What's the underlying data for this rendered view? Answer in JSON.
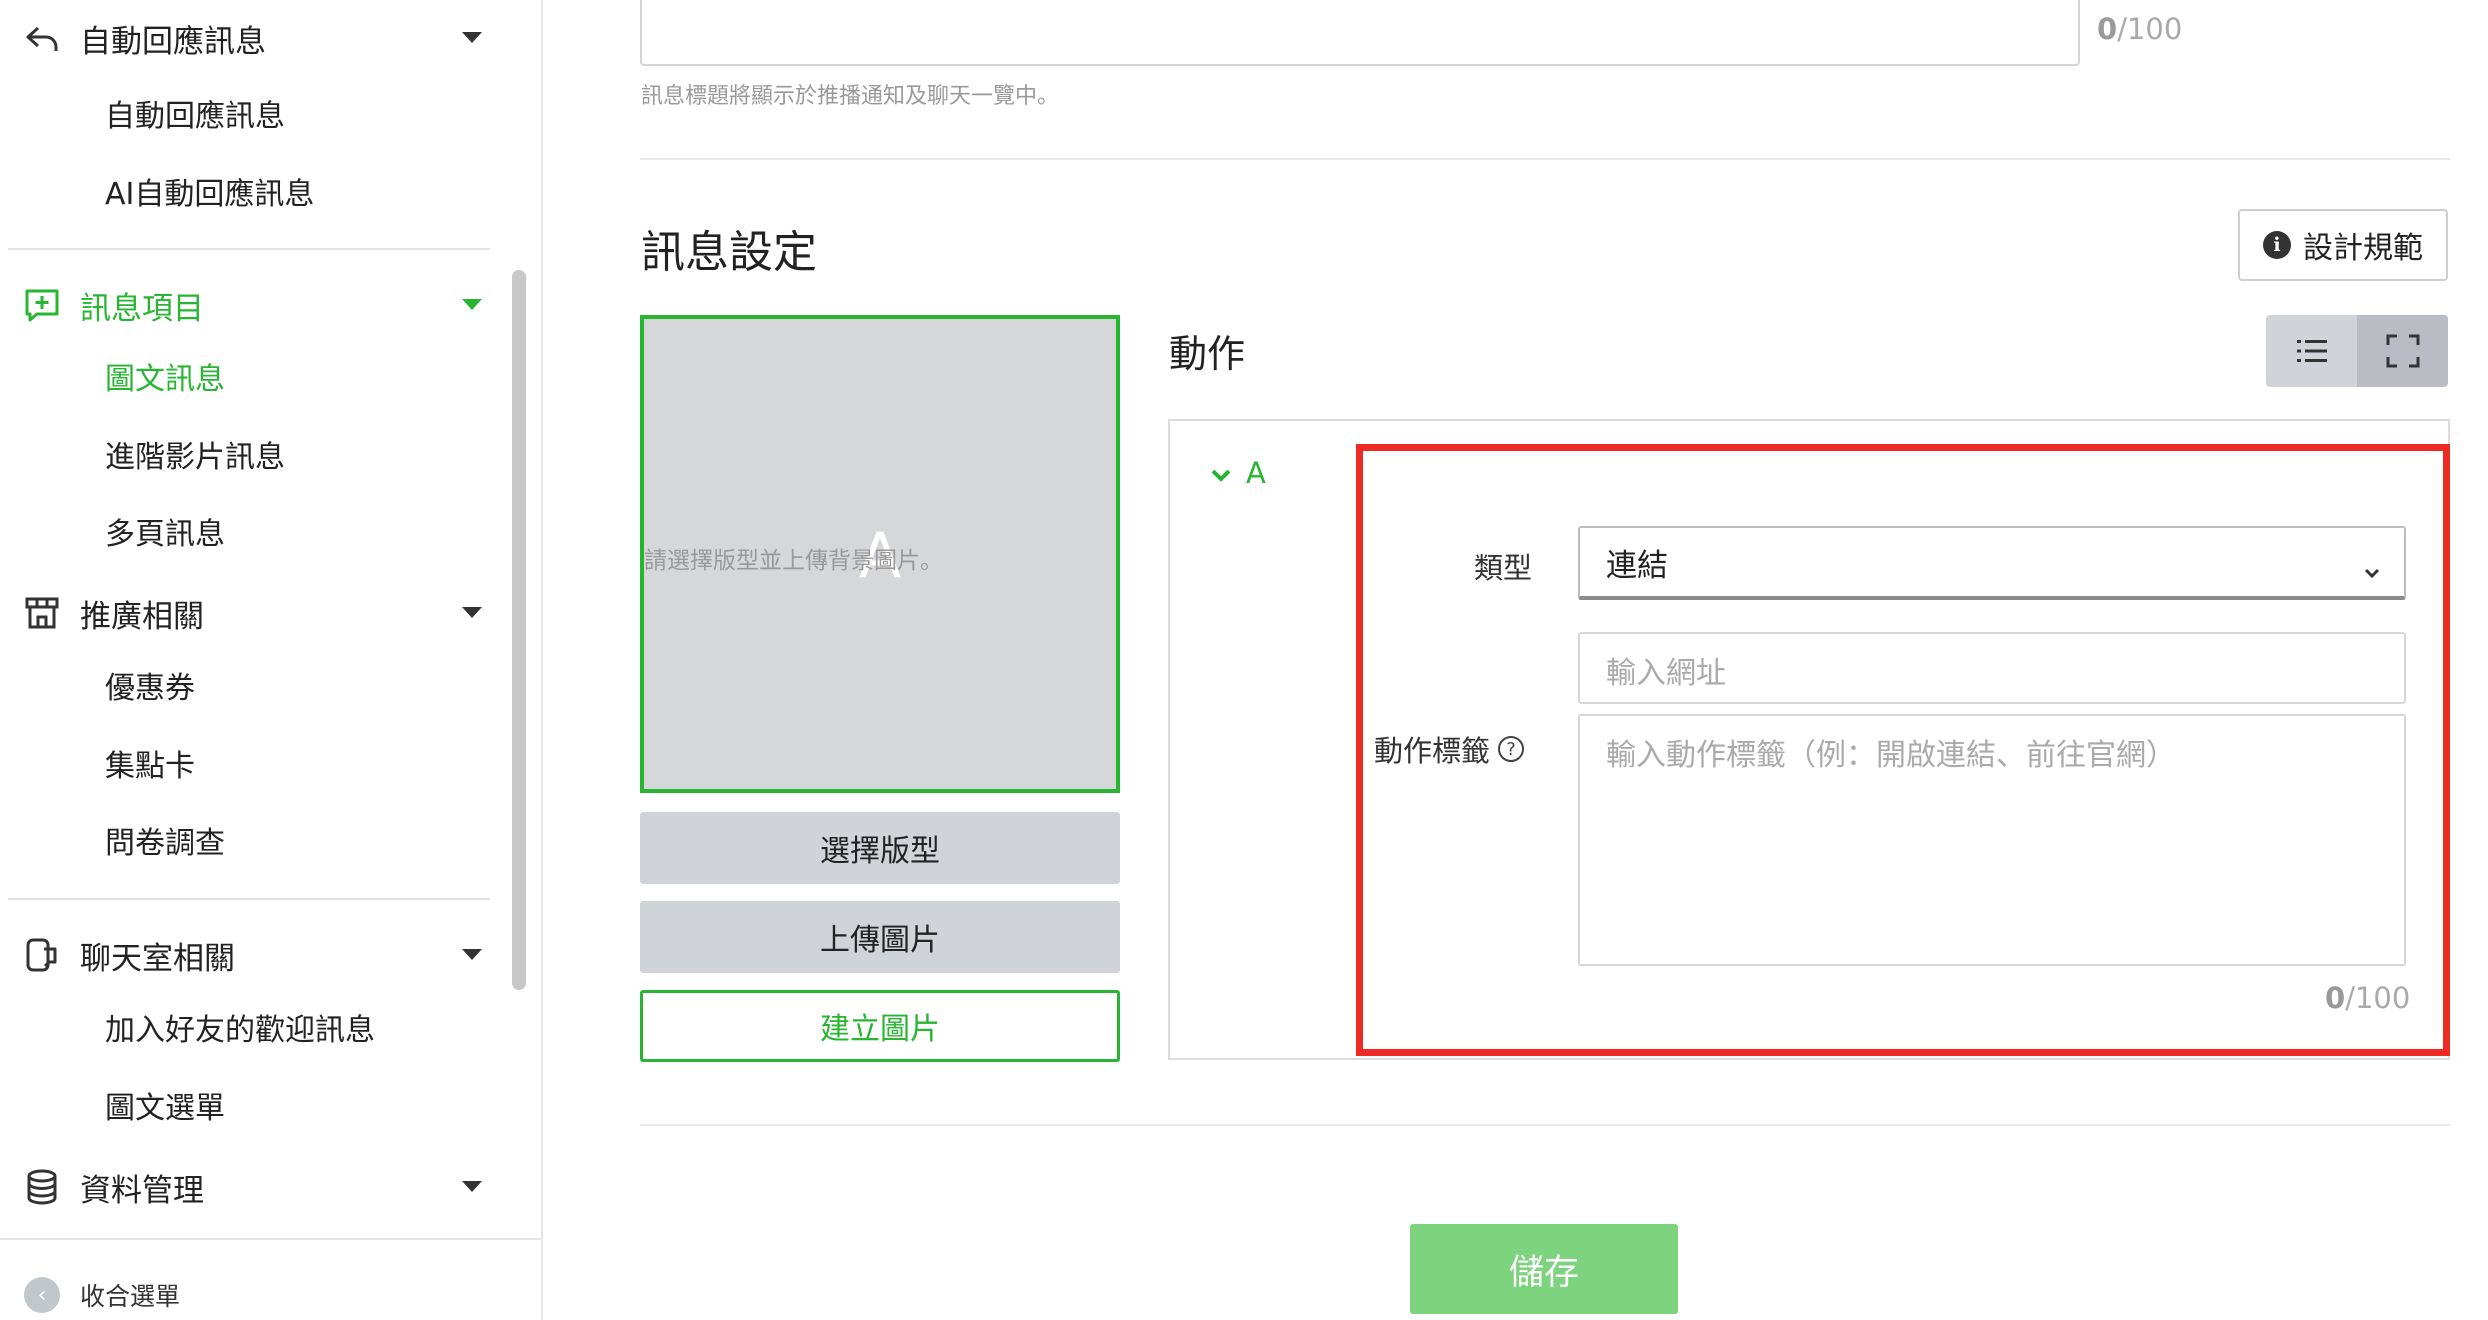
{
  "sidebar": {
    "groups": [
      {
        "label": "自動回應訊息",
        "icon": "reply-icon",
        "items": [
          "自動回應訊息",
          "AI自動回應訊息"
        ]
      },
      {
        "label": "訊息項目",
        "icon": "message-add-icon",
        "items": [
          "圖文訊息",
          "進階影片訊息",
          "多頁訊息"
        ],
        "active_item": "圖文訊息"
      },
      {
        "label": "推廣相關",
        "icon": "store-icon",
        "items": [
          "優惠券",
          "集點卡",
          "問卷調查"
        ]
      },
      {
        "label": "聊天室相關",
        "icon": "chat-icon",
        "items": [
          "加入好友的歡迎訊息",
          "圖文選單"
        ]
      },
      {
        "label": "資料管理",
        "icon": "database-icon",
        "items": []
      }
    ],
    "collapse_label": "收合選單"
  },
  "title_field": {
    "counter_current": "0",
    "counter_max": "/100",
    "hint": "訊息標題將顯示於推播通知及聊天一覽中。"
  },
  "message_settings": {
    "title": "訊息設定",
    "design_guide_label": "設計規範",
    "preview_hint": "請選擇版型並上傳背景圖片。",
    "preview_area_letter": "A",
    "buttons": {
      "choose_layout": "選擇版型",
      "upload_image": "上傳圖片",
      "create_image": "建立圖片"
    }
  },
  "action": {
    "title": "動作",
    "area_tab": "A",
    "type_label": "類型",
    "type_value": "連結",
    "url_placeholder": "輸入網址",
    "action_label_label": "動作標籤",
    "action_label_placeholder": "輸入動作標籤（例：開啟連結、前往官網）",
    "counter_current": "0",
    "counter_max": "/100"
  },
  "save_label": "儲存",
  "colors": {
    "accent": "#27b532",
    "highlight_box": "#ee2a24",
    "save_button": "#7dd37e"
  }
}
